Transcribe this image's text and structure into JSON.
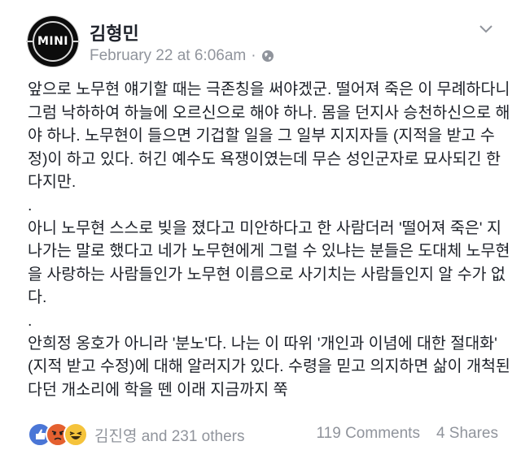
{
  "post": {
    "author": "김형민",
    "timestamp": "February 22 at 6:06am",
    "separator": "·",
    "avatar_logo_text": "MINI",
    "paragraphs": [
      "앞으로 노무현 얘기할 때는 극존칭을 써야겠군. 떨어져 죽은 이 무례하다니 그럼 낙하하여 하늘에 오르신으로 해야 하나. 몸을 던지사 승천하신으로 해야 하나. 노무현이 들으면 기겁할 일을 그 일부 지지자들 (지적을 받고 수정)이 하고 있다. 허긴 예수도 욕쟁이였는데 무슨 성인군자로 묘사되긴 한다지만.",
      ".",
      "아니 노무현 스스로 빚을 졌다고 미안하다고 한 사람더러 '떨어져 죽은' 지나가는 말로 했다고 네가 노무현에게 그럴 수 있냐는 분들은 도대체 노무현을 사랑하는 사람들인가 노무현 이름으로 사기치는 사람들인지 알 수가 없다.",
      ".",
      "안희정 옹호가 아니라 '분노'다. 나는 이 따위 '개인과 이념에 대한 절대화' (지적 받고 수정)에 대해 알러지가 있다. 수령을 믿고 의지하면 삶이 개척된다던 개소리에 학을 뗀 이래 지금까지 쭉"
    ]
  },
  "footer": {
    "reaction_icons": [
      "like-icon",
      "angry-icon",
      "haha-icon"
    ],
    "reactions_text": "김진영 and 231 others",
    "comments": "119 Comments",
    "shares": "4 Shares"
  },
  "colors": {
    "text": "#1d2129",
    "muted": "#90949c",
    "like": "#4a76d6",
    "angry": "#e4602f",
    "haha": "#f5c33b"
  }
}
